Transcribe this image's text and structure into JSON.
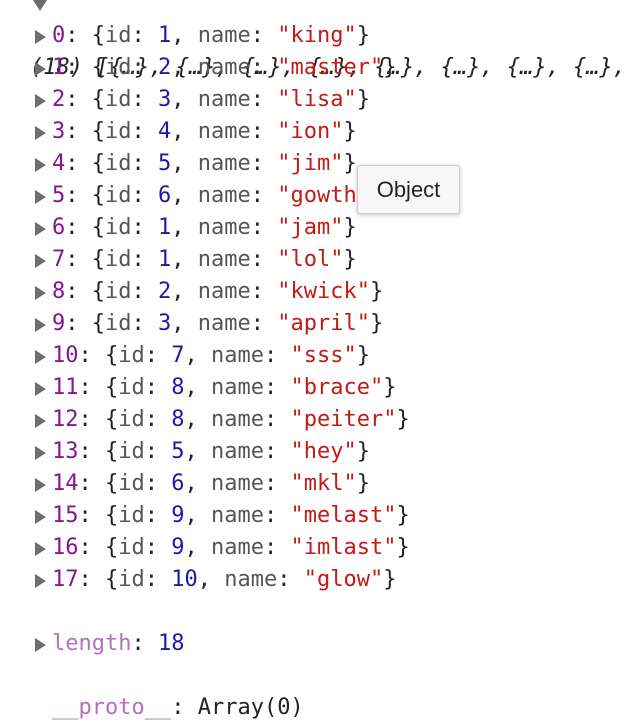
{
  "header": {
    "count": "(18)",
    "preview": "[{…}, {…}, {…}, {…}, {…}, {…}, {…}, {…},"
  },
  "items": [
    {
      "index": "0",
      "id": "1",
      "name": "\"king\""
    },
    {
      "index": "1",
      "id": "2",
      "name": "\"master\""
    },
    {
      "index": "2",
      "id": "3",
      "name": "\"lisa\""
    },
    {
      "index": "3",
      "id": "4",
      "name": "\"ion\""
    },
    {
      "index": "4",
      "id": "5",
      "name": "\"jim\""
    },
    {
      "index": "5",
      "id": "6",
      "name": "\"gowth"
    },
    {
      "index": "6",
      "id": "1",
      "name": "\"jam\""
    },
    {
      "index": "7",
      "id": "1",
      "name": "\"lol\""
    },
    {
      "index": "8",
      "id": "2",
      "name": "\"kwick\""
    },
    {
      "index": "9",
      "id": "3",
      "name": "\"april\""
    },
    {
      "index": "10",
      "id": "7",
      "name": "\"sss\""
    },
    {
      "index": "11",
      "id": "8",
      "name": "\"brace\""
    },
    {
      "index": "12",
      "id": "8",
      "name": "\"peiter\""
    },
    {
      "index": "13",
      "id": "5",
      "name": "\"hey\""
    },
    {
      "index": "14",
      "id": "6",
      "name": "\"mkl\""
    },
    {
      "index": "15",
      "id": "9",
      "name": "\"melast\""
    },
    {
      "index": "16",
      "id": "9",
      "name": "\"imlast\""
    },
    {
      "index": "17",
      "id": "10",
      "name": "\"glow\""
    }
  ],
  "labels": {
    "id": "id",
    "name": "name"
  },
  "length": {
    "key": "length",
    "value": "18"
  },
  "proto": {
    "key": "__proto__",
    "value": "Array(0)"
  },
  "tooltip": "Object"
}
